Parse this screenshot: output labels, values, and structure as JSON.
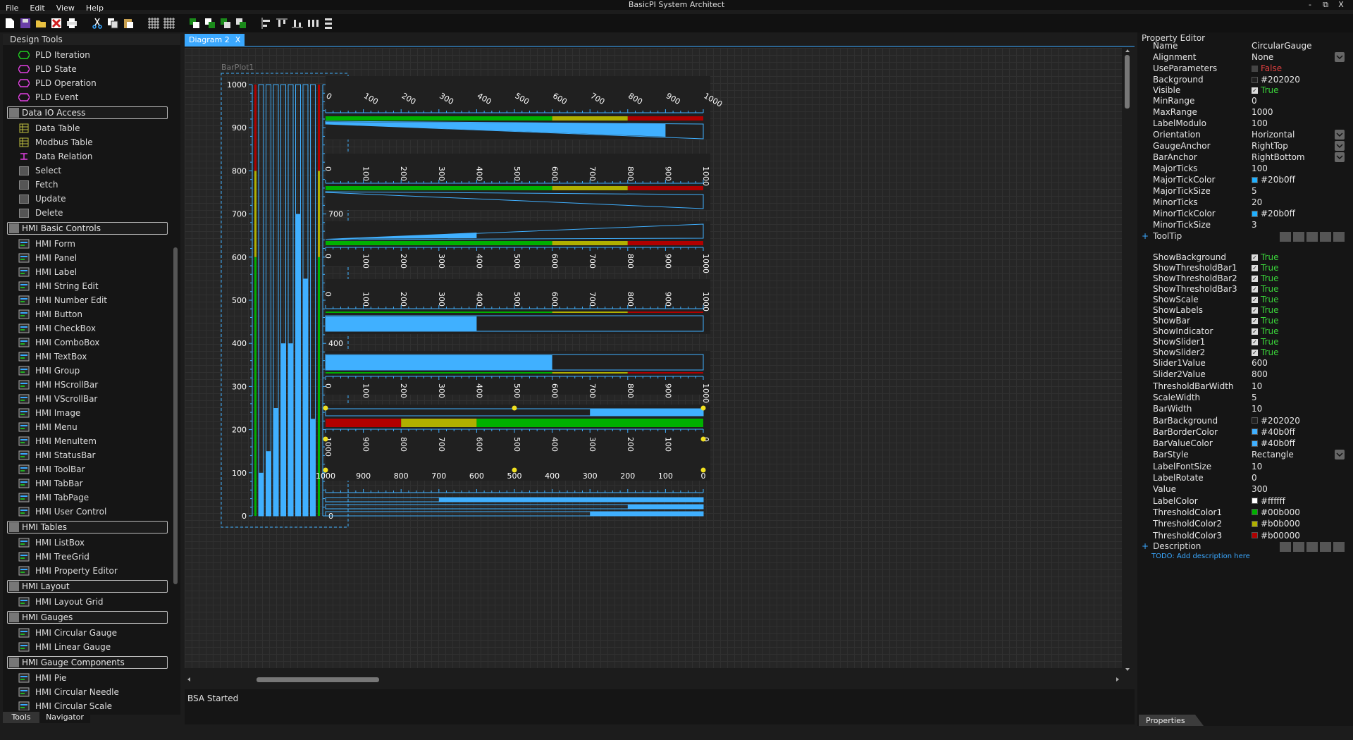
{
  "window": {
    "title": "BasicPI System Architect",
    "controls": [
      "-",
      "⧉",
      "X"
    ]
  },
  "menu": [
    "File",
    "Edit",
    "View",
    "Help"
  ],
  "left_panel": {
    "title": "Design Tools",
    "groups": [
      {
        "title": "",
        "items": [
          "PLD Iteration",
          "PLD State",
          "PLD Operation",
          "PLD Event"
        ]
      },
      {
        "title": "Data IO Access",
        "items": [
          "Data Table",
          "Modbus Table",
          "Data Relation",
          "Select",
          "Fetch",
          "Update",
          "Delete"
        ]
      },
      {
        "title": "HMI Basic Controls",
        "items": [
          "HMI Form",
          "HMI Panel",
          "HMI Label",
          "HMI String Edit",
          "HMI Number Edit",
          "HMI Button",
          "HMI CheckBox",
          "HMI ComboBox",
          "HMI TextBox",
          "HMI Group",
          "HMI HScrollBar",
          "HMI VScrollBar",
          "HMI Image",
          "HMI Menu",
          "HMI MenuItem",
          "HMI StatusBar",
          "HMI ToolBar",
          "HMI TabBar",
          "HMI TabPage",
          "HMI User Control"
        ]
      },
      {
        "title": "HMI Tables",
        "items": [
          "HMI ListBox",
          "HMI TreeGrid",
          "HMI Property Editor"
        ]
      },
      {
        "title": "HMI Layout",
        "items": [
          "HMI Layout Grid"
        ]
      },
      {
        "title": "HMI Gauges",
        "items": [
          "HMI Circular Gauge",
          "HMI Linear Gauge"
        ]
      },
      {
        "title": "HMI Gauge Components",
        "items": [
          "HMI Pie",
          "HMI Circular Needle",
          "HMI Circular Scale",
          "HMI Circular Labels"
        ]
      }
    ],
    "tabs": [
      "Tools",
      "Navigator"
    ]
  },
  "diagram": {
    "tab_label": "Diagram 2",
    "tab_close": "X",
    "barplot_label": "BarPlot1",
    "vertical_bar_values": [
      100,
      150,
      250,
      400,
      400,
      700,
      550,
      225
    ],
    "scale_labels": [
      "0",
      "100",
      "200",
      "300",
      "400",
      "500",
      "600",
      "700",
      "800",
      "900",
      "1000"
    ],
    "gauge_values": [
      900,
      0,
      400,
      400,
      600,
      300
    ],
    "thresholds": [
      600,
      800,
      1000
    ],
    "stacked_values": [
      700,
      200,
      300
    ]
  },
  "output": {
    "text": "BSA Started"
  },
  "property_editor": {
    "title": "Property Editor",
    "rows_a": [
      {
        "k": "Name",
        "v": "CircularGauge"
      },
      {
        "k": "Alignment",
        "v": "None",
        "dd": true
      },
      {
        "k": "UseParameters",
        "v": "False",
        "chk": "off"
      },
      {
        "k": "Background",
        "v": "#202020",
        "sw": "#202020"
      },
      {
        "k": "Visible",
        "v": "True",
        "chk": "on"
      },
      {
        "k": "MinRange",
        "v": "0"
      },
      {
        "k": "MaxRange",
        "v": "1000"
      },
      {
        "k": "LabelModulo",
        "v": "100"
      },
      {
        "k": "Orientation",
        "v": "Horizontal",
        "dd": true
      },
      {
        "k": "GaugeAnchor",
        "v": "RightTop",
        "dd": true
      },
      {
        "k": "BarAnchor",
        "v": "RightBottom",
        "dd": true
      },
      {
        "k": "MajorTicks",
        "v": "100"
      },
      {
        "k": "MajorTickColor",
        "v": "#20b0ff",
        "sw": "#20b0ff"
      },
      {
        "k": "MajorTickSize",
        "v": "5"
      },
      {
        "k": "MinorTicks",
        "v": "20"
      },
      {
        "k": "MinorTickColor",
        "v": "#20b0ff",
        "sw": "#20b0ff"
      },
      {
        "k": "MinorTickSize",
        "v": "3"
      }
    ],
    "tooltip_group": "ToolTip",
    "rows_b": [
      {
        "k": "ShowBackground",
        "v": "True",
        "chk": "on"
      },
      {
        "k": "ShowThresholdBar1",
        "v": "True",
        "chk": "on"
      },
      {
        "k": "ShowThresholdBar2",
        "v": "True",
        "chk": "on"
      },
      {
        "k": "ShowThresholdBar3",
        "v": "True",
        "chk": "on"
      },
      {
        "k": "ShowScale",
        "v": "True",
        "chk": "on"
      },
      {
        "k": "ShowLabels",
        "v": "True",
        "chk": "on"
      },
      {
        "k": "ShowBar",
        "v": "True",
        "chk": "on"
      },
      {
        "k": "ShowIndicator",
        "v": "True",
        "chk": "on"
      },
      {
        "k": "ShowSlider1",
        "v": "True",
        "chk": "on"
      },
      {
        "k": "ShowSlider2",
        "v": "True",
        "chk": "on"
      },
      {
        "k": "Slider1Value",
        "v": "600"
      },
      {
        "k": "Slider2Value",
        "v": "800"
      },
      {
        "k": "ThresholdBarWidth",
        "v": "10"
      },
      {
        "k": "ScaleWidth",
        "v": "5"
      },
      {
        "k": "BarWidth",
        "v": "10"
      },
      {
        "k": "BarBackground",
        "v": "#202020",
        "sw": "#202020"
      },
      {
        "k": "BarBorderColor",
        "v": "#40b0ff",
        "sw": "#40b0ff"
      },
      {
        "k": "BarValueColor",
        "v": "#40b0ff",
        "sw": "#40b0ff"
      },
      {
        "k": "BarStyle",
        "v": "Rectangle",
        "dd": true
      },
      {
        "k": "LabelFontSize",
        "v": "10"
      },
      {
        "k": "LabelRotate",
        "v": "0"
      },
      {
        "k": "Value",
        "v": "300"
      },
      {
        "k": "LabelColor",
        "v": "#ffffff",
        "sw": "#ffffff"
      },
      {
        "k": "ThresholdColor1",
        "v": "#00b000",
        "sw": "#00b000"
      },
      {
        "k": "ThresholdColor2",
        "v": "#b0b000",
        "sw": "#b0b000"
      },
      {
        "k": "ThresholdColor3",
        "v": "#b00000",
        "sw": "#b00000"
      }
    ],
    "description_group": "Description",
    "description_text": "TODO: Add description here",
    "tab": "Properties"
  },
  "colors": {
    "accent": "#3aa8ff",
    "bar": "#40b0ff",
    "green": "#00b000",
    "yellow": "#b0b000",
    "red": "#b00000"
  }
}
